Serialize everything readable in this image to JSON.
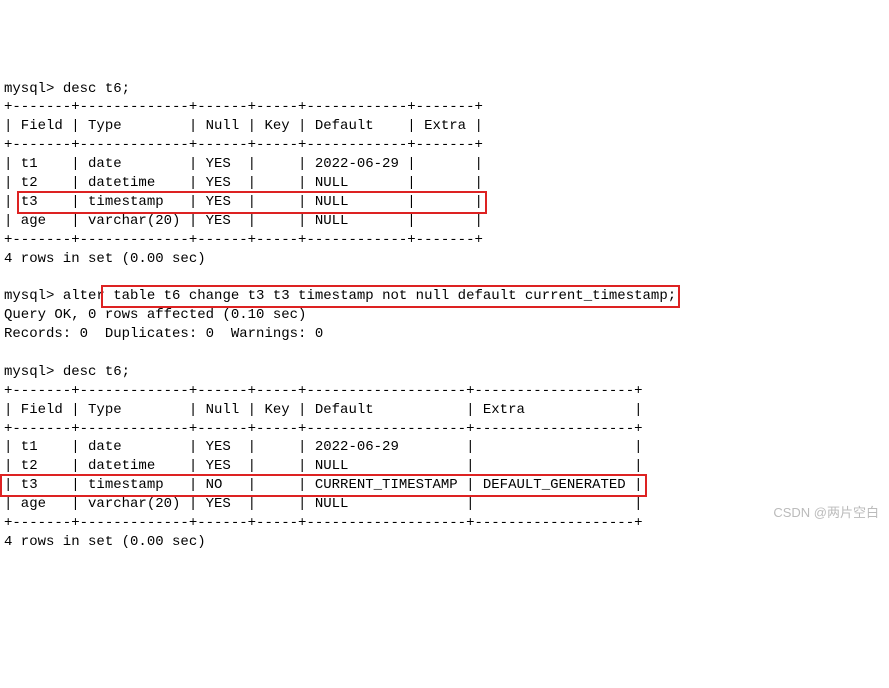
{
  "prompt": "mysql> ",
  "cmd1": "desc t6;",
  "cmd2_pre": "alter",
  "cmd2_box": " table t6 change t3 t3 timestamp not null default current_timestamp;",
  "cmd3": "desc t6;",
  "t1": {
    "sep": "+-------+-------------+------+-----+------------+-------+",
    "head": "| Field | Type        | Null | Key | Default    | Extra |",
    "r1": "| t1    | date        | YES  |     | 2022-06-29 |       |",
    "r2": "| t2    | datetime    | YES  |     | NULL       |       |",
    "r3a": "| ",
    "r3b": "t3    | timestamp   | YES  |     | NULL       |       |",
    "r4": "| age   | varchar(20) | YES  |     | NULL       |       |"
  },
  "status_rows": "4 rows in set (0.00 sec)",
  "alter_ok": "Query OK, 0 rows affected (0.10 sec)",
  "alter_rec": "Records: 0  Duplicates: 0  Warnings: 0",
  "t2": {
    "sep": "+-------+-------------+------+-----+-------------------+-------------------+",
    "head": "| Field | Type        | Null | Key | Default           | Extra             |",
    "r1": "| t1    | date        | YES  |     | 2022-06-29        |                   |",
    "r2": "| t2    | datetime    | YES  |     | NULL              |                   |",
    "r3": "| t3    | timestamp   | NO   |     | CURRENT_TIMESTAMP | DEFAULT_GENERATED |",
    "r4": "| age   | varchar(20) | YES  |     | NULL              |                   |"
  },
  "watermark": "CSDN @两片空白"
}
